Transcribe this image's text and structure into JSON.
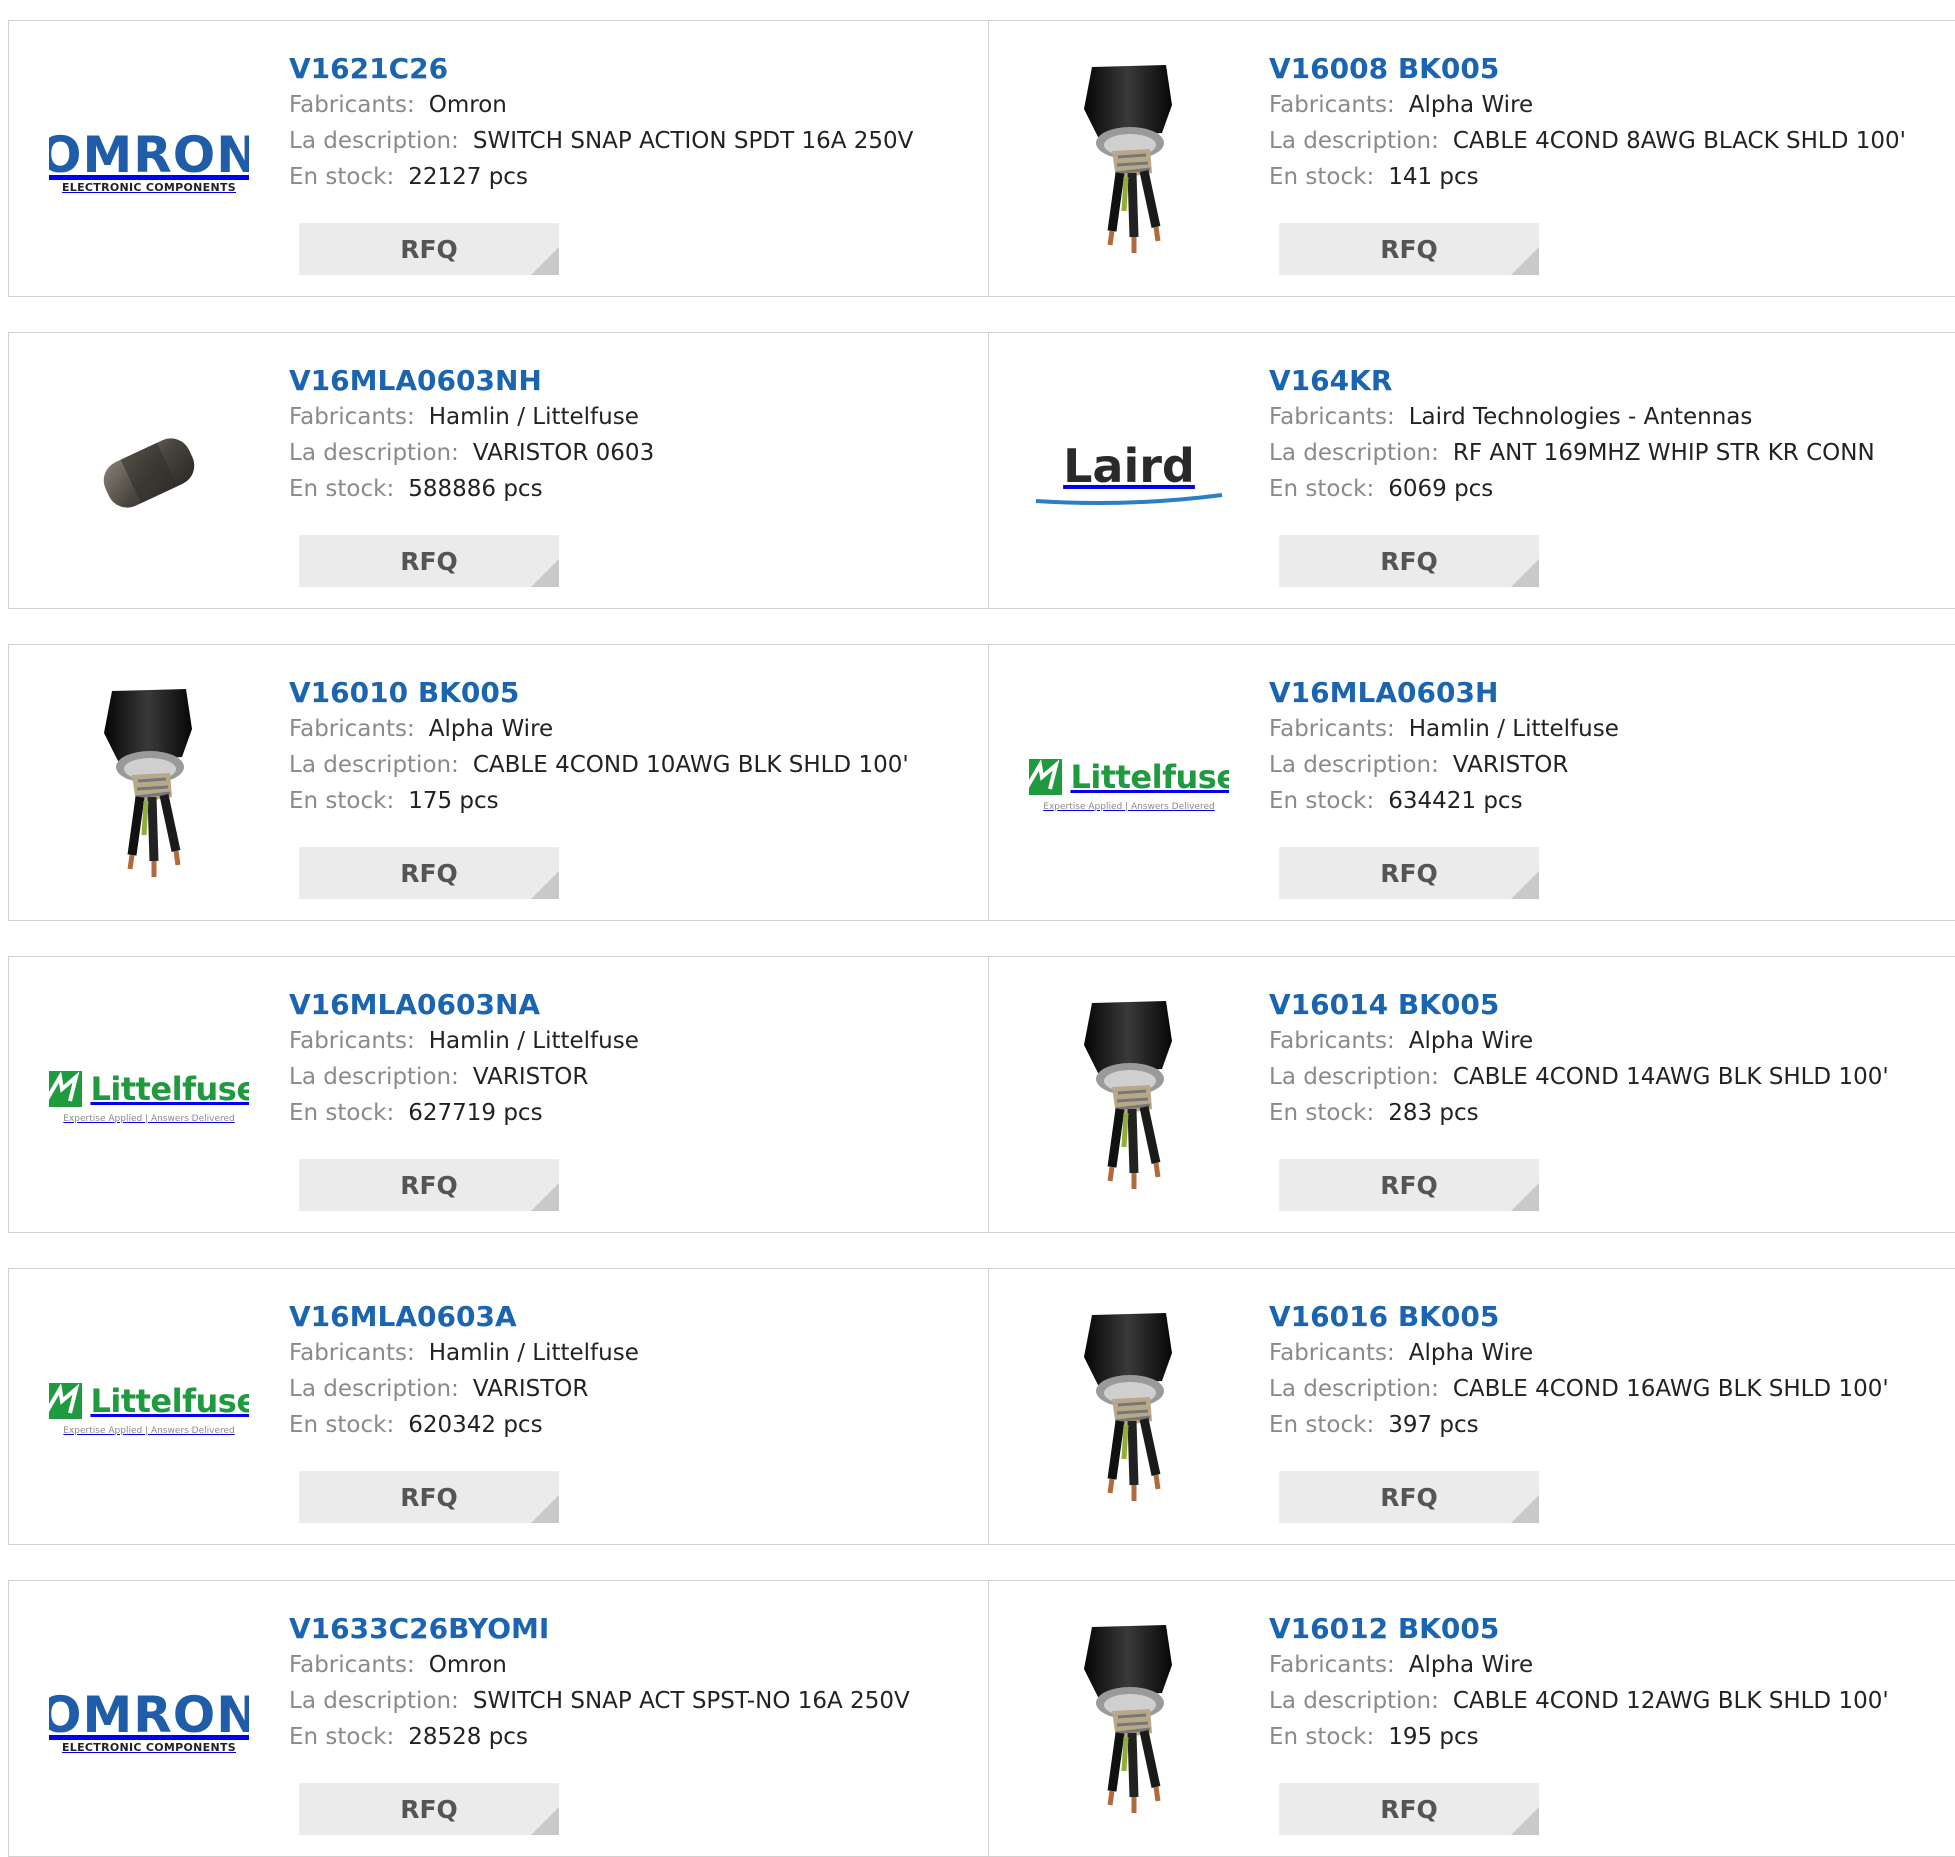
{
  "labels": {
    "manufacturer": "Fabricants:",
    "description": "La description:",
    "stock": "En stock:",
    "rfq": "RFQ"
  },
  "colors": {
    "part_link": "#1a64b0",
    "label_gray": "#8a8a8a",
    "rfq_bg": "#ebebeb",
    "border": "#d2d2d2",
    "omron_blue": "#1f5da8",
    "littelfuse_green": "#1f9a3e"
  },
  "logo_text": {
    "omron": "OMRON",
    "omron_sub": "ELECTRONIC COMPONENTS",
    "laird": "Laird",
    "littelfuse": "Littelfuse",
    "littelfuse_tag": "Expertise Applied | Answers Delivered"
  },
  "products": [
    {
      "part": "V1621C26",
      "manufacturer": "Omron",
      "description": "SWITCH SNAP ACTION SPDT 16A 250V",
      "stock": "22127 pcs",
      "image": "omron-logo"
    },
    {
      "part": "V16008 BK005",
      "manufacturer": "Alpha Wire",
      "description": "CABLE 4COND 8AWG BLACK SHLD 100'",
      "stock": "141 pcs",
      "image": "cable-photo"
    },
    {
      "part": "V16MLA0603NH",
      "manufacturer": "Hamlin / Littelfuse",
      "description": "VARISTOR 0603",
      "stock": "588886 pcs",
      "image": "chip-varistor-photo"
    },
    {
      "part": "V164KR",
      "manufacturer": "Laird Technologies - Antennas",
      "description": "RF ANT 169MHZ WHIP STR KR CONN",
      "stock": "6069 pcs",
      "image": "laird-logo"
    },
    {
      "part": "V16010 BK005",
      "manufacturer": "Alpha Wire",
      "description": "CABLE 4COND 10AWG BLK SHLD 100'",
      "stock": "175 pcs",
      "image": "cable-photo"
    },
    {
      "part": "V16MLA0603H",
      "manufacturer": "Hamlin / Littelfuse",
      "description": "VARISTOR",
      "stock": "634421 pcs",
      "image": "littelfuse-logo"
    },
    {
      "part": "V16MLA0603NA",
      "manufacturer": "Hamlin / Littelfuse",
      "description": "VARISTOR",
      "stock": "627719 pcs",
      "image": "littelfuse-logo"
    },
    {
      "part": "V16014 BK005",
      "manufacturer": "Alpha Wire",
      "description": "CABLE 4COND 14AWG BLK SHLD 100'",
      "stock": "283 pcs",
      "image": "cable-photo"
    },
    {
      "part": "V16MLA0603A",
      "manufacturer": "Hamlin / Littelfuse",
      "description": "VARISTOR",
      "stock": "620342 pcs",
      "image": "littelfuse-logo"
    },
    {
      "part": "V16016 BK005",
      "manufacturer": "Alpha Wire",
      "description": "CABLE 4COND 16AWG BLK SHLD 100'",
      "stock": "397 pcs",
      "image": "cable-photo"
    },
    {
      "part": "V1633C26BYOMI",
      "manufacturer": "Omron",
      "description": "SWITCH SNAP ACT SPST-NO 16A 250V",
      "stock": "28528 pcs",
      "image": "omron-logo"
    },
    {
      "part": "V16012 BK005",
      "manufacturer": "Alpha Wire",
      "description": "CABLE 4COND 12AWG BLK SHLD 100'",
      "stock": "195 pcs",
      "image": "cable-photo"
    }
  ]
}
